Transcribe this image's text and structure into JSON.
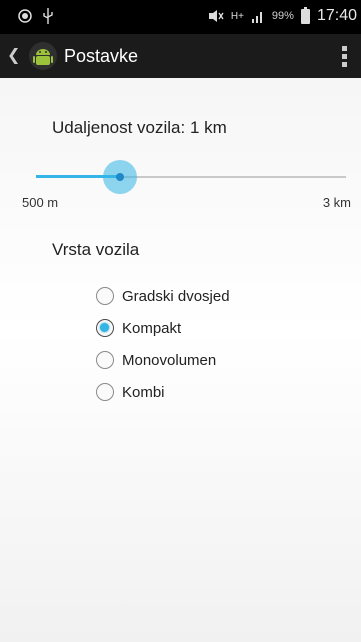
{
  "status_bar": {
    "battery_text": "99%",
    "time": "17:40",
    "network_text": "H+"
  },
  "action_bar": {
    "title": "Postavke"
  },
  "slider": {
    "label": "Udaljenost vozila: 1 km",
    "min_label": "500 m",
    "max_label": "3 km",
    "fraction": 0.27
  },
  "vehicle_type": {
    "title": "Vrsta vozila",
    "options": [
      {
        "label": "Gradski dvosjed",
        "checked": false
      },
      {
        "label": "Kompakt",
        "checked": true
      },
      {
        "label": "Monovolumen",
        "checked": false
      },
      {
        "label": "Kombi",
        "checked": false
      }
    ]
  },
  "colors": {
    "accent": "#33b5e5",
    "action_bar": "#1b1b1b",
    "status_bar": "#000000"
  }
}
